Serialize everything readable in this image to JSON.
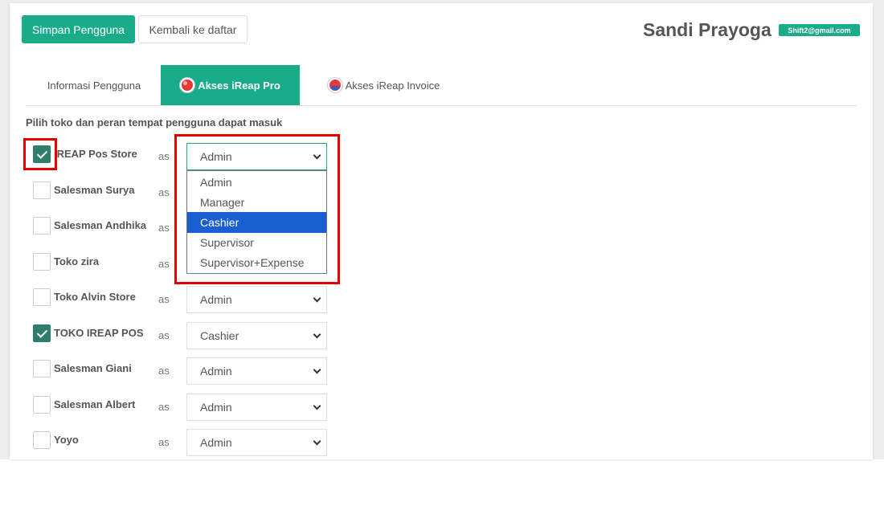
{
  "header": {
    "save_label": "Simpan Pengguna",
    "back_label": "Kembali ke daftar",
    "user_name": "Sandi Prayoga",
    "email": "Shift2@gmail.com"
  },
  "tabs": [
    {
      "label": "Informasi Pengguna",
      "active": false
    },
    {
      "label": "Akses iReap Pro",
      "active": true,
      "icon": "ireap-pro-icon"
    },
    {
      "label": "Akses iReap Invoice",
      "active": false,
      "icon": "ireap-invoice-icon"
    }
  ],
  "section": {
    "title": "Pilih toko dan peran tempat pengguna dapat masuk"
  },
  "as_label": "as",
  "stores": [
    {
      "name": "iREAP Pos Store",
      "checked": true,
      "role": "Admin"
    },
    {
      "name": "Salesman Surya",
      "checked": false,
      "role": ""
    },
    {
      "name": "Salesman Andhika",
      "checked": false,
      "role": ""
    },
    {
      "name": "Toko zira",
      "checked": false,
      "role": ""
    },
    {
      "name": "Toko Alvin Store",
      "checked": false,
      "role": "Admin"
    },
    {
      "name": "TOKO IREAP POS",
      "checked": true,
      "role": "Cashier"
    },
    {
      "name": "Salesman Giani",
      "checked": false,
      "role": "Admin"
    },
    {
      "name": "Salesman Albert",
      "checked": false,
      "role": "Admin"
    },
    {
      "name": "Yoyo",
      "checked": false,
      "role": "Admin"
    }
  ],
  "dropdown": {
    "options": [
      "Admin",
      "Manager",
      "Cashier",
      "Supervisor",
      "Supervisor+Expense"
    ],
    "highlighted": "Cashier"
  },
  "colors": {
    "accent": "#1aab8a",
    "checkbox_checked": "#2e7d6d",
    "highlight_box": "#e00000",
    "dropdown_selected": "#1a5fd1"
  }
}
